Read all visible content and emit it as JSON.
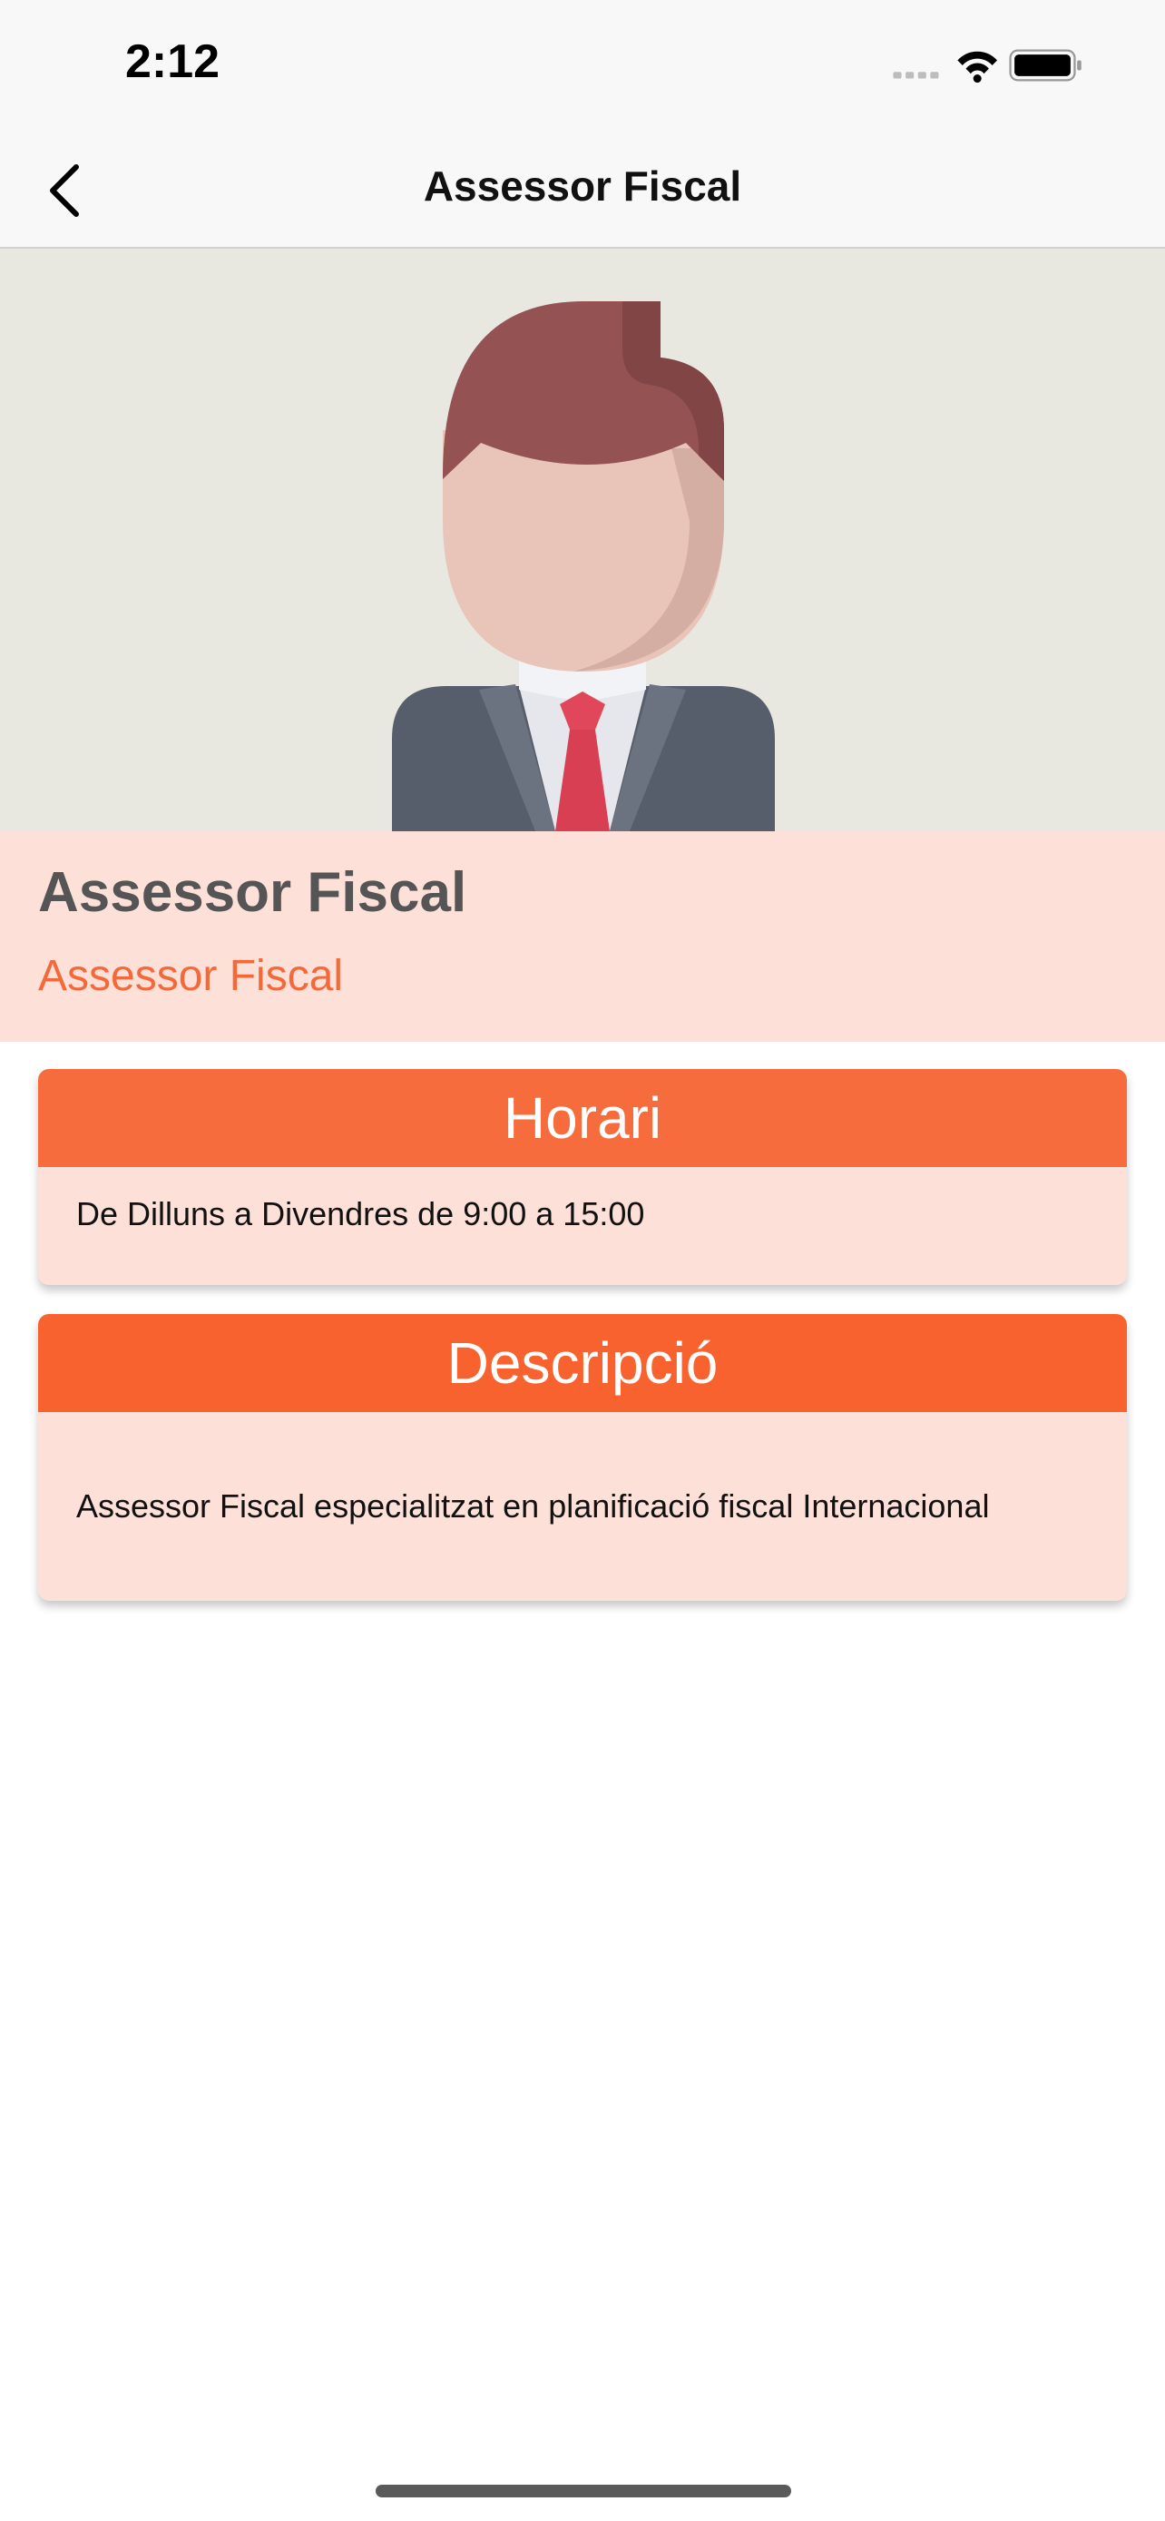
{
  "status_bar": {
    "time": "2:12"
  },
  "nav": {
    "title": "Assessor Fiscal"
  },
  "profile": {
    "name": "Assessor Fiscal",
    "role": "Assessor Fiscal"
  },
  "horari": {
    "title": "Horari",
    "text": "De Dilluns a Divendres de 9:00 a 15:00"
  },
  "descripcio": {
    "title": "Descripció",
    "text": "Assessor Fiscal especialitzat en planificació fiscal Internacional"
  },
  "colors": {
    "accent": "#f76c3d",
    "panel": "#fde0d8",
    "hero_bg": "#e8e8e1"
  }
}
